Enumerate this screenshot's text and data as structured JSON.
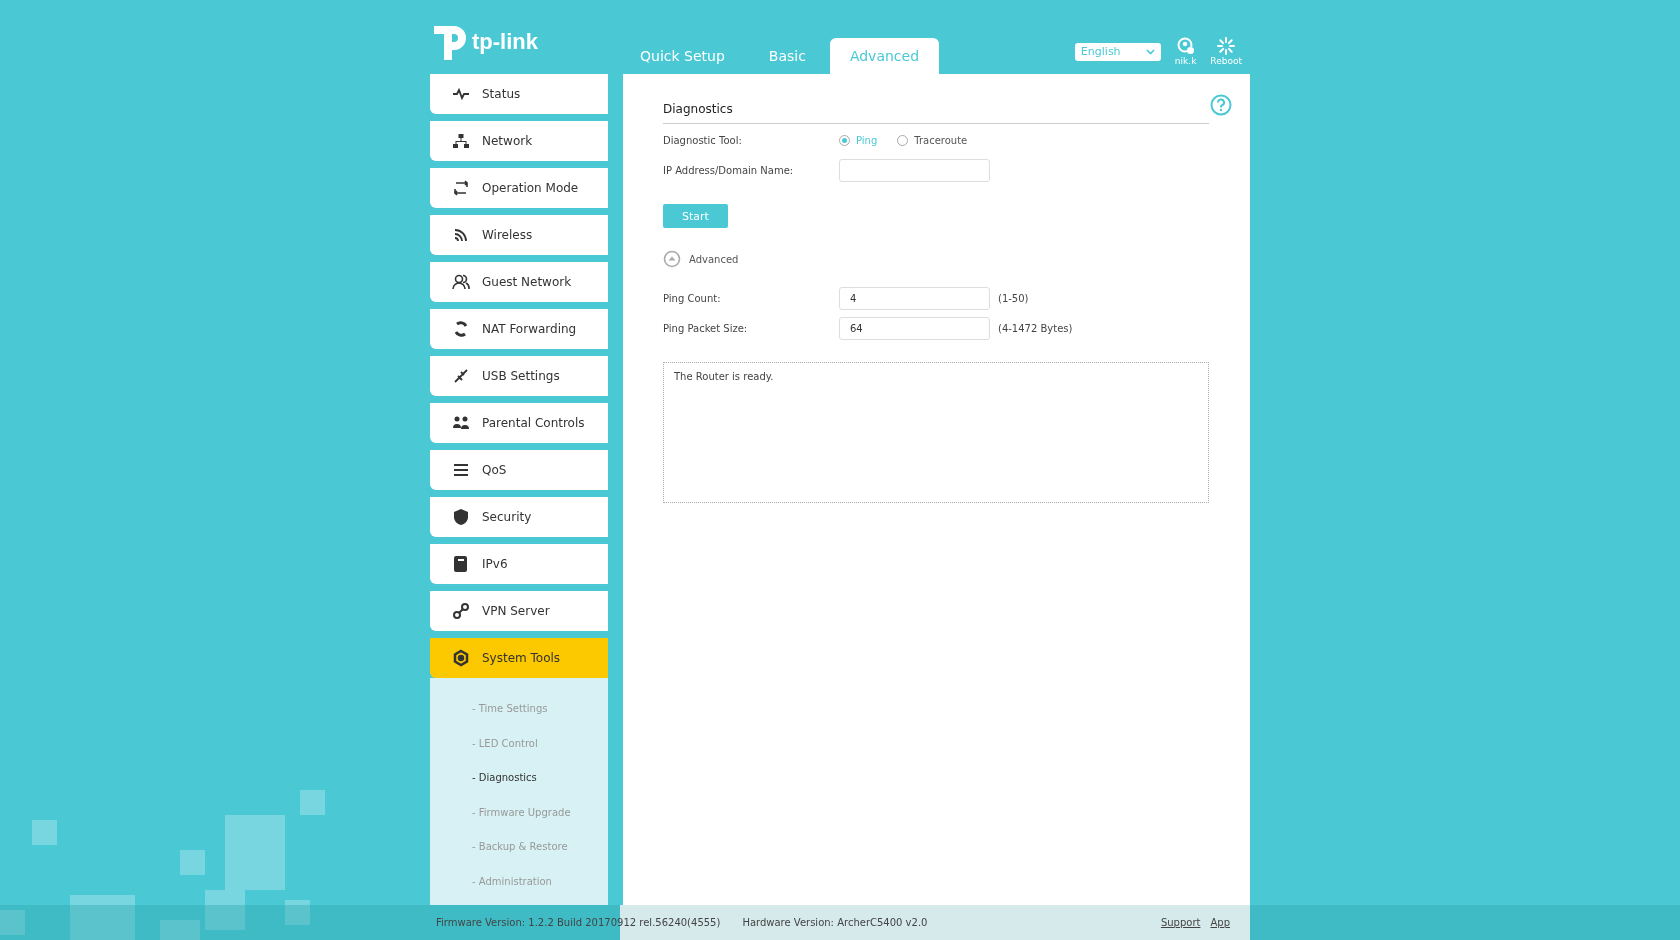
{
  "header": {
    "logo": "tp-link",
    "tabs": [
      {
        "label": "Quick Setup",
        "selected": false
      },
      {
        "label": "Basic",
        "selected": false
      },
      {
        "label": "Advanced",
        "selected": true
      }
    ],
    "language": "English",
    "user": "nik.k",
    "reboot": "Reboot"
  },
  "sidebar": [
    {
      "label": "Status",
      "selected": false
    },
    {
      "label": "Network",
      "selected": false
    },
    {
      "label": "Operation Mode",
      "selected": false
    },
    {
      "label": "Wireless",
      "selected": false
    },
    {
      "label": "Guest Network",
      "selected": false
    },
    {
      "label": "NAT Forwarding",
      "selected": false
    },
    {
      "label": "USB Settings",
      "selected": false
    },
    {
      "label": "Parental Controls",
      "selected": false
    },
    {
      "label": "QoS",
      "selected": false
    },
    {
      "label": "Security",
      "selected": false
    },
    {
      "label": "IPv6",
      "selected": false
    },
    {
      "label": "VPN Server",
      "selected": false
    },
    {
      "label": "System Tools",
      "selected": true,
      "children": [
        {
          "label": "- Time Settings",
          "selected": false
        },
        {
          "label": "- LED Control",
          "selected": false
        },
        {
          "label": "- Diagnostics",
          "selected": true
        },
        {
          "label": "- Firmware Upgrade",
          "selected": false
        },
        {
          "label": "- Backup & Restore",
          "selected": false
        },
        {
          "label": "- Administration",
          "selected": false
        }
      ]
    }
  ],
  "content": {
    "title": "Diagnostics",
    "tool_label": "Diagnostic Tool:",
    "tool_options": [
      {
        "label": "Ping",
        "selected": true
      },
      {
        "label": "Traceroute",
        "selected": false
      }
    ],
    "address_label": "IP Address/Domain Name:",
    "start": "Start",
    "advanced": {
      "label": "Advanced",
      "expanded": true,
      "fields": [
        {
          "label": "Ping Count:",
          "value": "4",
          "hint": "(1-50)"
        },
        {
          "label": "Ping Packet Size:",
          "value": "64",
          "hint": "(4-1472 Bytes)"
        }
      ]
    },
    "output": "The Router is ready."
  },
  "footer": {
    "firmware": "Firmware Version: 1.2.2 Build 20170912 rel.56240(4555)",
    "hardware": "Hardware Version: ArcherC5400 v2.0",
    "links": [
      "Support",
      "App"
    ]
  }
}
